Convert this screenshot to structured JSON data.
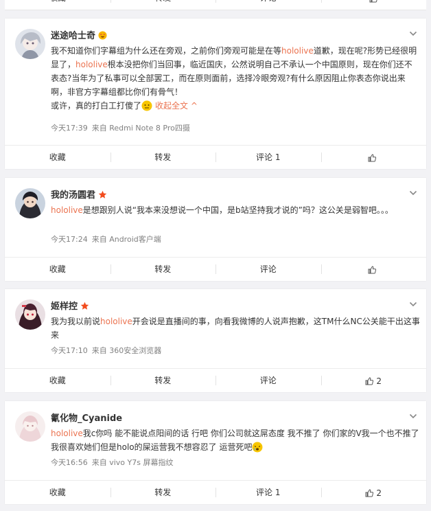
{
  "top_bar": {
    "favorite": "收藏",
    "repost": "转发",
    "comment": "评论",
    "like_count": ""
  },
  "comments": [
    {
      "username": "迷途哈士奇",
      "badge": "emoji-badge",
      "text_a": "我不知道你们字幕组为什么还在旁观，之前你们旁观可能是在等",
      "hl_1": "hololive",
      "text_b": "道歉，现在呢?形势已经很明显了，",
      "hl_2": "hololive",
      "text_c": "根本没把你们当回事，临近国庆，公然说明自己不承认一个中国原则，现在你们还不表态?当年为了私事可以全部罢工，而在原则面前，选择冷眼旁观?有什么原因阻止你表态你说出来啊，非官方字幕组都比你们有骨气！",
      "text_d": "或许，真的打白工打傻了",
      "collapse": "收起全文",
      "time": "今天17:39",
      "source": "来自 Redmi Note 8 Pro四摄",
      "favorite": "收藏",
      "repost": "转发",
      "comment": "评论 1",
      "like_count": ""
    },
    {
      "username": "我的汤圆君",
      "badge": "red-star",
      "hl_1": "hololive",
      "text_a": "是想跟别人说“我本来没想说一个中国，是b站坚持我才说的”吗？这公关是弱智吧。。。",
      "time": "今天17:24",
      "source": "来自 Android客户端",
      "favorite": "收藏",
      "repost": "转发",
      "comment": "评论",
      "like_count": ""
    },
    {
      "username": "姬样控",
      "badge": "red-star",
      "text_a": "我为我以前说",
      "hl_1": "hololive",
      "text_b": "开会说是直播间的事，向看我微博的人说声抱歉，这TM什么NC公关能干出这事来",
      "time": "今天17:10",
      "source": "来自 360安全浏览器",
      "favorite": "收藏",
      "repost": "转发",
      "comment": "评论",
      "like_count": "2"
    },
    {
      "username": "氰化物_Cyanide",
      "badge": "",
      "hl_1": "hololive",
      "text_a": "我c你吗 能不能说点阳间的话 行吧 你们公司就这屌态度 我不推了 你们家的V我一个也不推了 我很喜欢她们但是holo的屎运营我不想容忍了 运营死吧",
      "time": "今天16:56",
      "source": "来自 vivo Y7s 屏幕指纹",
      "favorite": "收藏",
      "repost": "转发",
      "comment": "评论 1",
      "like_count": "2"
    }
  ],
  "colors": {
    "link": "#eb7350",
    "text": "#333333",
    "meta": "#808080"
  }
}
